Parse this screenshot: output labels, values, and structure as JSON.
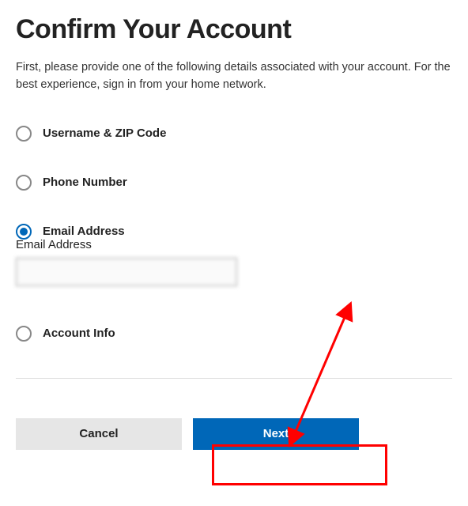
{
  "heading": "Confirm Your Account",
  "subtitle": "First, please provide one of the following details associated with your account. For the best experience, sign in from your home network.",
  "options": {
    "username_zip": {
      "label": "Username & ZIP Code",
      "selected": false
    },
    "phone": {
      "label": "Phone Number",
      "selected": false
    },
    "email": {
      "label": "Email Address",
      "selected": true
    },
    "account_info": {
      "label": "Account Info",
      "selected": false
    }
  },
  "email_field": {
    "label": "Email Address",
    "value": ""
  },
  "buttons": {
    "cancel": "Cancel",
    "next": "Next"
  },
  "annotation": {
    "highlight": "next-button",
    "arrow_color": "#ff0000"
  }
}
